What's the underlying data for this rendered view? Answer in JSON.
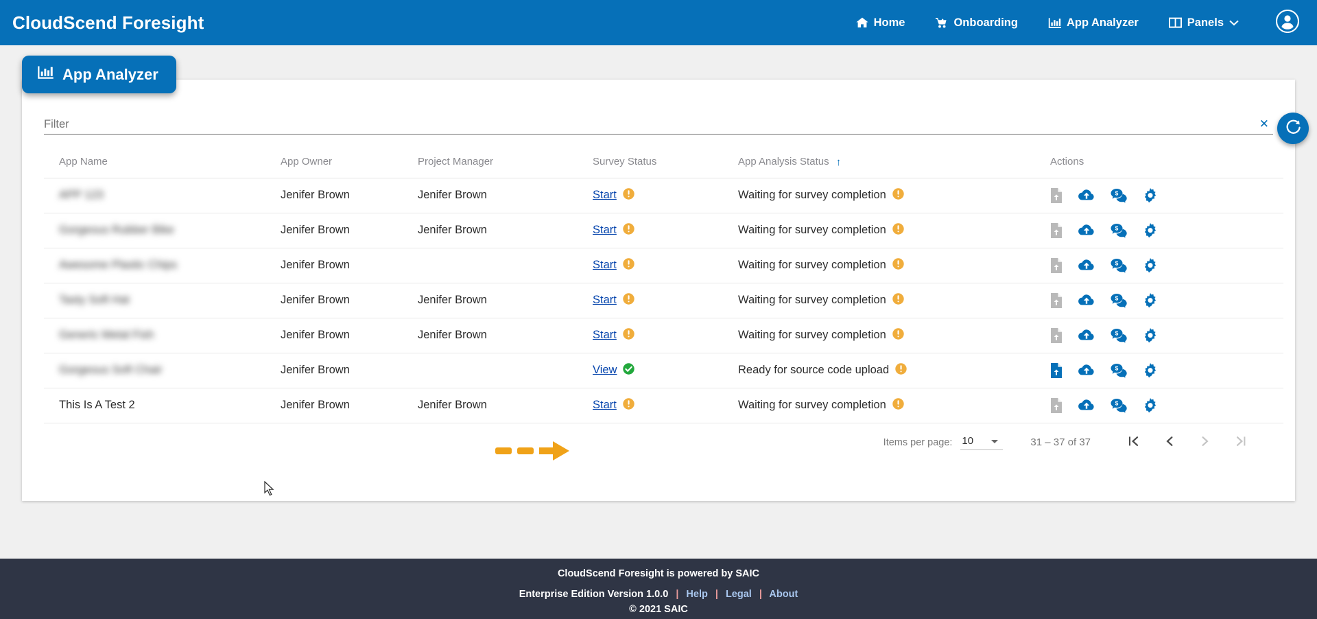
{
  "header": {
    "brand": "CloudScend Foresight",
    "nav": [
      {
        "label": "Home",
        "icon": "home-icon"
      },
      {
        "label": "Onboarding",
        "icon": "onboarding-icon"
      },
      {
        "label": "App Analyzer",
        "icon": "bar-chart-icon"
      },
      {
        "label": "Panels",
        "icon": "panels-icon",
        "caret": true
      }
    ],
    "account_icon": "user-account-icon"
  },
  "tab": {
    "label": "App Analyzer",
    "icon": "bar-chart-icon"
  },
  "filter": {
    "placeholder": "Filter",
    "value": "",
    "clear_icon": "close-icon",
    "refresh_icon": "refresh-icon"
  },
  "table": {
    "columns": [
      {
        "key": "app_name",
        "label": "App Name"
      },
      {
        "key": "app_owner",
        "label": "App Owner"
      },
      {
        "key": "project_manager",
        "label": "Project Manager"
      },
      {
        "key": "survey_status",
        "label": "Survey Status"
      },
      {
        "key": "app_analysis_status",
        "label": "App Analysis Status",
        "sorted": "asc",
        "sort_icon": "arrow-up-icon"
      },
      {
        "key": "actions",
        "label": "Actions"
      }
    ],
    "rows": [
      {
        "app_name": "APP 123",
        "app_name_redacted": true,
        "app_owner": "Jenifer Brown",
        "project_manager": "Jenifer Brown",
        "survey_link": "Start",
        "survey_icon": "info-circle-icon",
        "analysis_status": "Waiting for survey completion",
        "analysis_icon": "info-circle-icon",
        "file_upload_enabled": false
      },
      {
        "app_name": "Gorgeous Rubber Bike",
        "app_name_redacted": true,
        "app_owner": "Jenifer Brown",
        "project_manager": "Jenifer Brown",
        "survey_link": "Start",
        "survey_icon": "info-circle-icon",
        "analysis_status": "Waiting for survey completion",
        "analysis_icon": "info-circle-icon",
        "file_upload_enabled": false
      },
      {
        "app_name": "Awesome Plastic Chips",
        "app_name_redacted": true,
        "app_owner": "Jenifer Brown",
        "project_manager": "",
        "survey_link": "Start",
        "survey_icon": "info-circle-icon",
        "analysis_status": "Waiting for survey completion",
        "analysis_icon": "info-circle-icon",
        "file_upload_enabled": false
      },
      {
        "app_name": "Tasty Soft Hat",
        "app_name_redacted": true,
        "app_owner": "Jenifer Brown",
        "project_manager": "Jenifer Brown",
        "survey_link": "Start",
        "survey_icon": "info-circle-icon",
        "analysis_status": "Waiting for survey completion",
        "analysis_icon": "info-circle-icon",
        "file_upload_enabled": false
      },
      {
        "app_name": "Generic Metal Fish",
        "app_name_redacted": true,
        "app_owner": "Jenifer Brown",
        "project_manager": "Jenifer Brown",
        "survey_link": "Start",
        "survey_icon": "info-circle-icon",
        "analysis_status": "Waiting for survey completion",
        "analysis_icon": "info-circle-icon",
        "file_upload_enabled": false
      },
      {
        "app_name": "Gorgeous Soft Chair",
        "app_name_redacted": true,
        "app_owner": "Jenifer Brown",
        "project_manager": "",
        "survey_link": "View",
        "survey_icon": "check-circle-icon",
        "analysis_status": "Ready for source code upload",
        "analysis_icon": "info-circle-icon",
        "file_upload_enabled": true
      },
      {
        "app_name": "This Is A Test 2",
        "app_name_redacted": false,
        "app_owner": "Jenifer Brown",
        "project_manager": "Jenifer Brown",
        "survey_link": "Start",
        "survey_icon": "info-circle-icon",
        "analysis_status": "Waiting for survey completion",
        "analysis_icon": "info-circle-icon",
        "file_upload_enabled": false
      }
    ],
    "action_icons": [
      "file-upload-icon",
      "cloud-upload-icon",
      "cost-chat-icon",
      "gear-icon"
    ]
  },
  "paginator": {
    "items_per_page_label": "Items per page:",
    "items_per_page_value": "10",
    "range_label": "31 – 37 of 37",
    "buttons": [
      {
        "name": "first-page-button",
        "icon": "first-page-icon",
        "disabled": false
      },
      {
        "name": "previous-page-button",
        "icon": "chevron-left-icon",
        "disabled": false
      },
      {
        "name": "next-page-button",
        "icon": "chevron-right-icon",
        "disabled": true
      },
      {
        "name": "last-page-button",
        "icon": "last-page-icon",
        "disabled": true
      }
    ]
  },
  "footer": {
    "line1": "CloudScend Foresight is powered by SAIC",
    "version": "Enterprise Edition Version 1.0.0",
    "links": [
      "Help",
      "Legal",
      "About"
    ],
    "separator": "|",
    "copyright": "© 2021 SAIC"
  },
  "annotation": {
    "arrow_color": "#F0A218",
    "points_at": "Start"
  },
  "colors": {
    "brand_blue": "#0670b8",
    "link_blue": "#0645ad",
    "warning_amber": "#f0ad3c",
    "success_green": "#22a83c",
    "footer_dark": "#2f3545"
  }
}
